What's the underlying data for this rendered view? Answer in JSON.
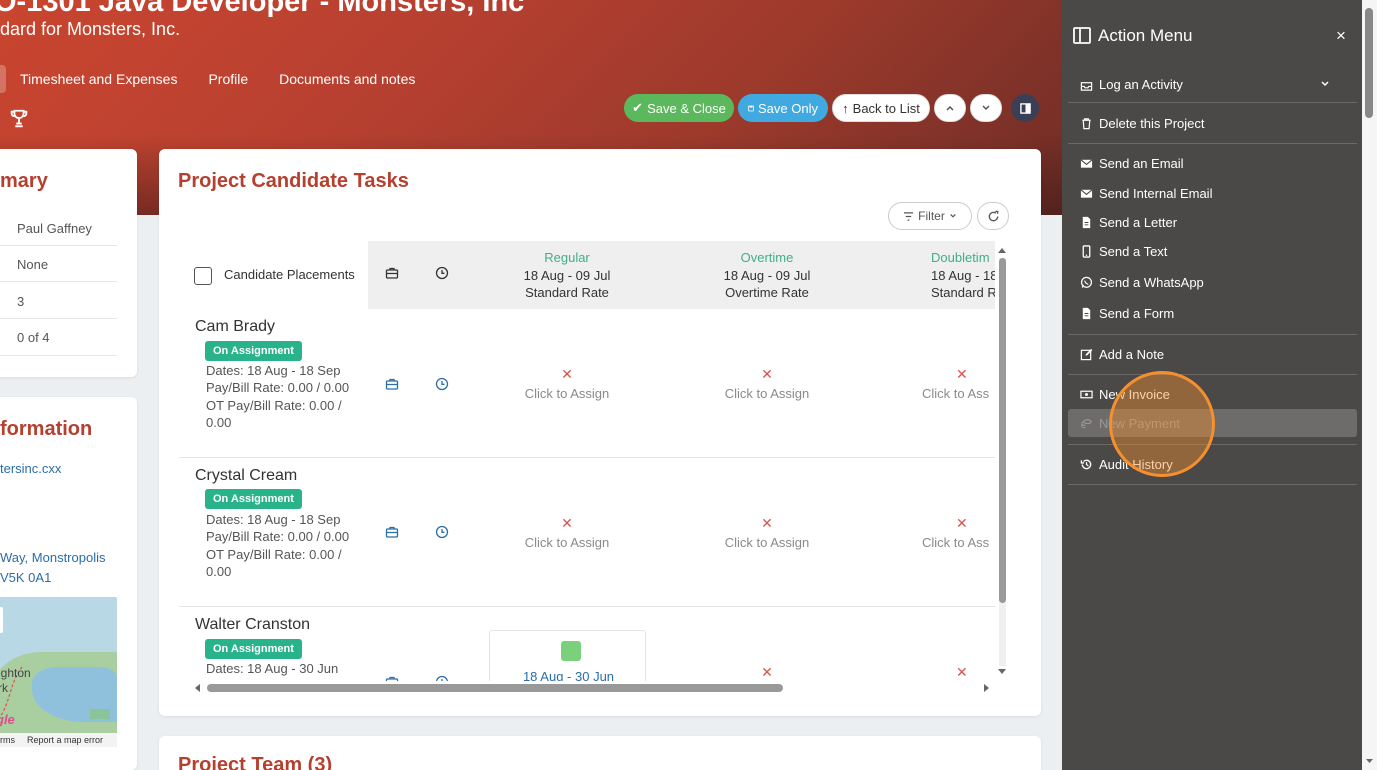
{
  "header": {
    "title": "O-1301 Java Developer - Monsters, Inc",
    "subtitle": "dard for Monsters, Inc.",
    "tabs": [
      "Timesheet and Expenses",
      "Profile",
      "Documents and notes"
    ]
  },
  "toolbar": {
    "save_close": "Save & Close",
    "save_only": "Save Only",
    "back_to_list": "Back to List"
  },
  "summary": {
    "title": "mary",
    "rows": [
      "Paul Gaffney",
      "None",
      "3",
      "0 of 4"
    ]
  },
  "info": {
    "title": "formation",
    "website": "tersinc.cxx",
    "address_line1": "Way, Monstropolis",
    "address_line2": "V5K 0A1",
    "map_label1": "ighton",
    "map_label2": "rk",
    "map_logo": "gle",
    "map_terms": "rms",
    "map_report": "Report a map error"
  },
  "tasks": {
    "title": "Project Candidate Tasks",
    "filter_label": "Filter",
    "header_label": "Candidate Placements",
    "columns": [
      {
        "type": "Regular",
        "dates": "18 Aug - 09 Jul",
        "rate": "Standard Rate"
      },
      {
        "type": "Overtime",
        "dates": "18 Aug - 09 Jul",
        "rate": "Overtime Rate"
      },
      {
        "type": "Doubletim",
        "dates": "18 Aug - 18 S",
        "rate": "Standard Ra"
      }
    ],
    "assign_label": "Click to Assign",
    "assign_label_cut": "Click to Ass",
    "candidates": [
      {
        "name": "Cam Brady",
        "status": "On Assignment",
        "dates": "Dates: 18 Aug - 18 Sep",
        "pay": "Pay/Bill Rate: 0.00 / 0.00",
        "ot": "OT Pay/Bill Rate: 0.00 / 0.00"
      },
      {
        "name": "Crystal Cream",
        "status": "On Assignment",
        "dates": "Dates: 18 Aug - 18 Sep",
        "pay": "Pay/Bill Rate: 0.00 / 0.00",
        "ot": "OT Pay/Bill Rate: 0.00 / 0.00"
      },
      {
        "name": "Walter Cranston",
        "status": "On Assignment",
        "dates": "Dates: 18 Aug - 30 Jun",
        "assigned_dates": "18 Aug - 30 Jun"
      }
    ]
  },
  "team": {
    "title": "Project Team (3)"
  },
  "action_menu": {
    "title": "Action Menu",
    "close": "×",
    "items": [
      "Log an Activity",
      "Delete this Project",
      "Send an Email",
      "Send Internal Email",
      "Send a Letter",
      "Send a Text",
      "Send a WhatsApp",
      "Send a Form",
      "Add a Note",
      "New Invoice",
      "New Payment",
      "Audit History"
    ]
  },
  "colors": {
    "accent_red": "#b5402f",
    "green": "#5cb85c",
    "blue": "#3fa9e0",
    "teal": "#28b38a",
    "panel": "#4a4948",
    "cursor": "#f5902e"
  }
}
